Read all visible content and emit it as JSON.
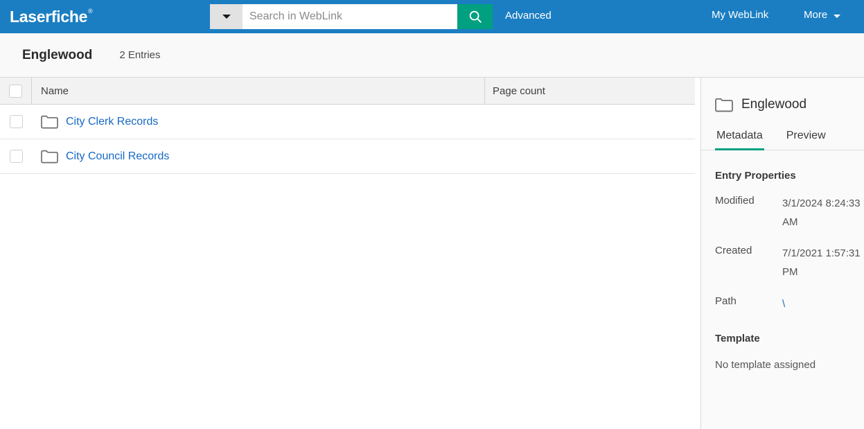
{
  "header": {
    "logo_text": "Laserfiche",
    "logo_registered": "®",
    "search": {
      "placeholder": "Search in WebLink",
      "value": "",
      "dropdown_icon": "chevron-down-icon",
      "search_icon": "search-icon"
    },
    "advanced_label": "Advanced",
    "my_weblink_label": "My WebLink",
    "more_label": "More",
    "more_icon": "chevron-down-icon",
    "bar_color": "#1b7ec2",
    "search_button_color": "#00a080"
  },
  "breadcrumb": {
    "title": "Englewood",
    "entry_count": "2 Entries"
  },
  "list": {
    "columns": [
      {
        "key": "name",
        "label": "Name"
      },
      {
        "key": "pagecount",
        "label": "Page count"
      }
    ],
    "select_all_checked": false,
    "rows": [
      {
        "icon": "folder-icon",
        "name": "City Clerk Records",
        "pagecount": "",
        "checked": false
      },
      {
        "icon": "folder-icon",
        "name": "City Council Records",
        "pagecount": "",
        "checked": false
      }
    ],
    "link_color": "#1568c6"
  },
  "panel": {
    "icon": "folder-icon",
    "title": "Englewood",
    "tabs": [
      {
        "label": "Metadata",
        "active": true
      },
      {
        "label": "Preview",
        "active": false
      }
    ],
    "active_tab_color": "#00a080",
    "entry_properties": {
      "heading": "Entry Properties",
      "rows": [
        {
          "label": "Modified",
          "value": "3/1/2024 8:24:33 AM",
          "is_link": false
        },
        {
          "label": "Created",
          "value": "7/1/2021 1:57:31 PM",
          "is_link": false
        },
        {
          "label": "Path",
          "value": "\\",
          "is_link": true
        }
      ]
    },
    "template": {
      "heading": "Template",
      "value": "No template assigned"
    }
  }
}
